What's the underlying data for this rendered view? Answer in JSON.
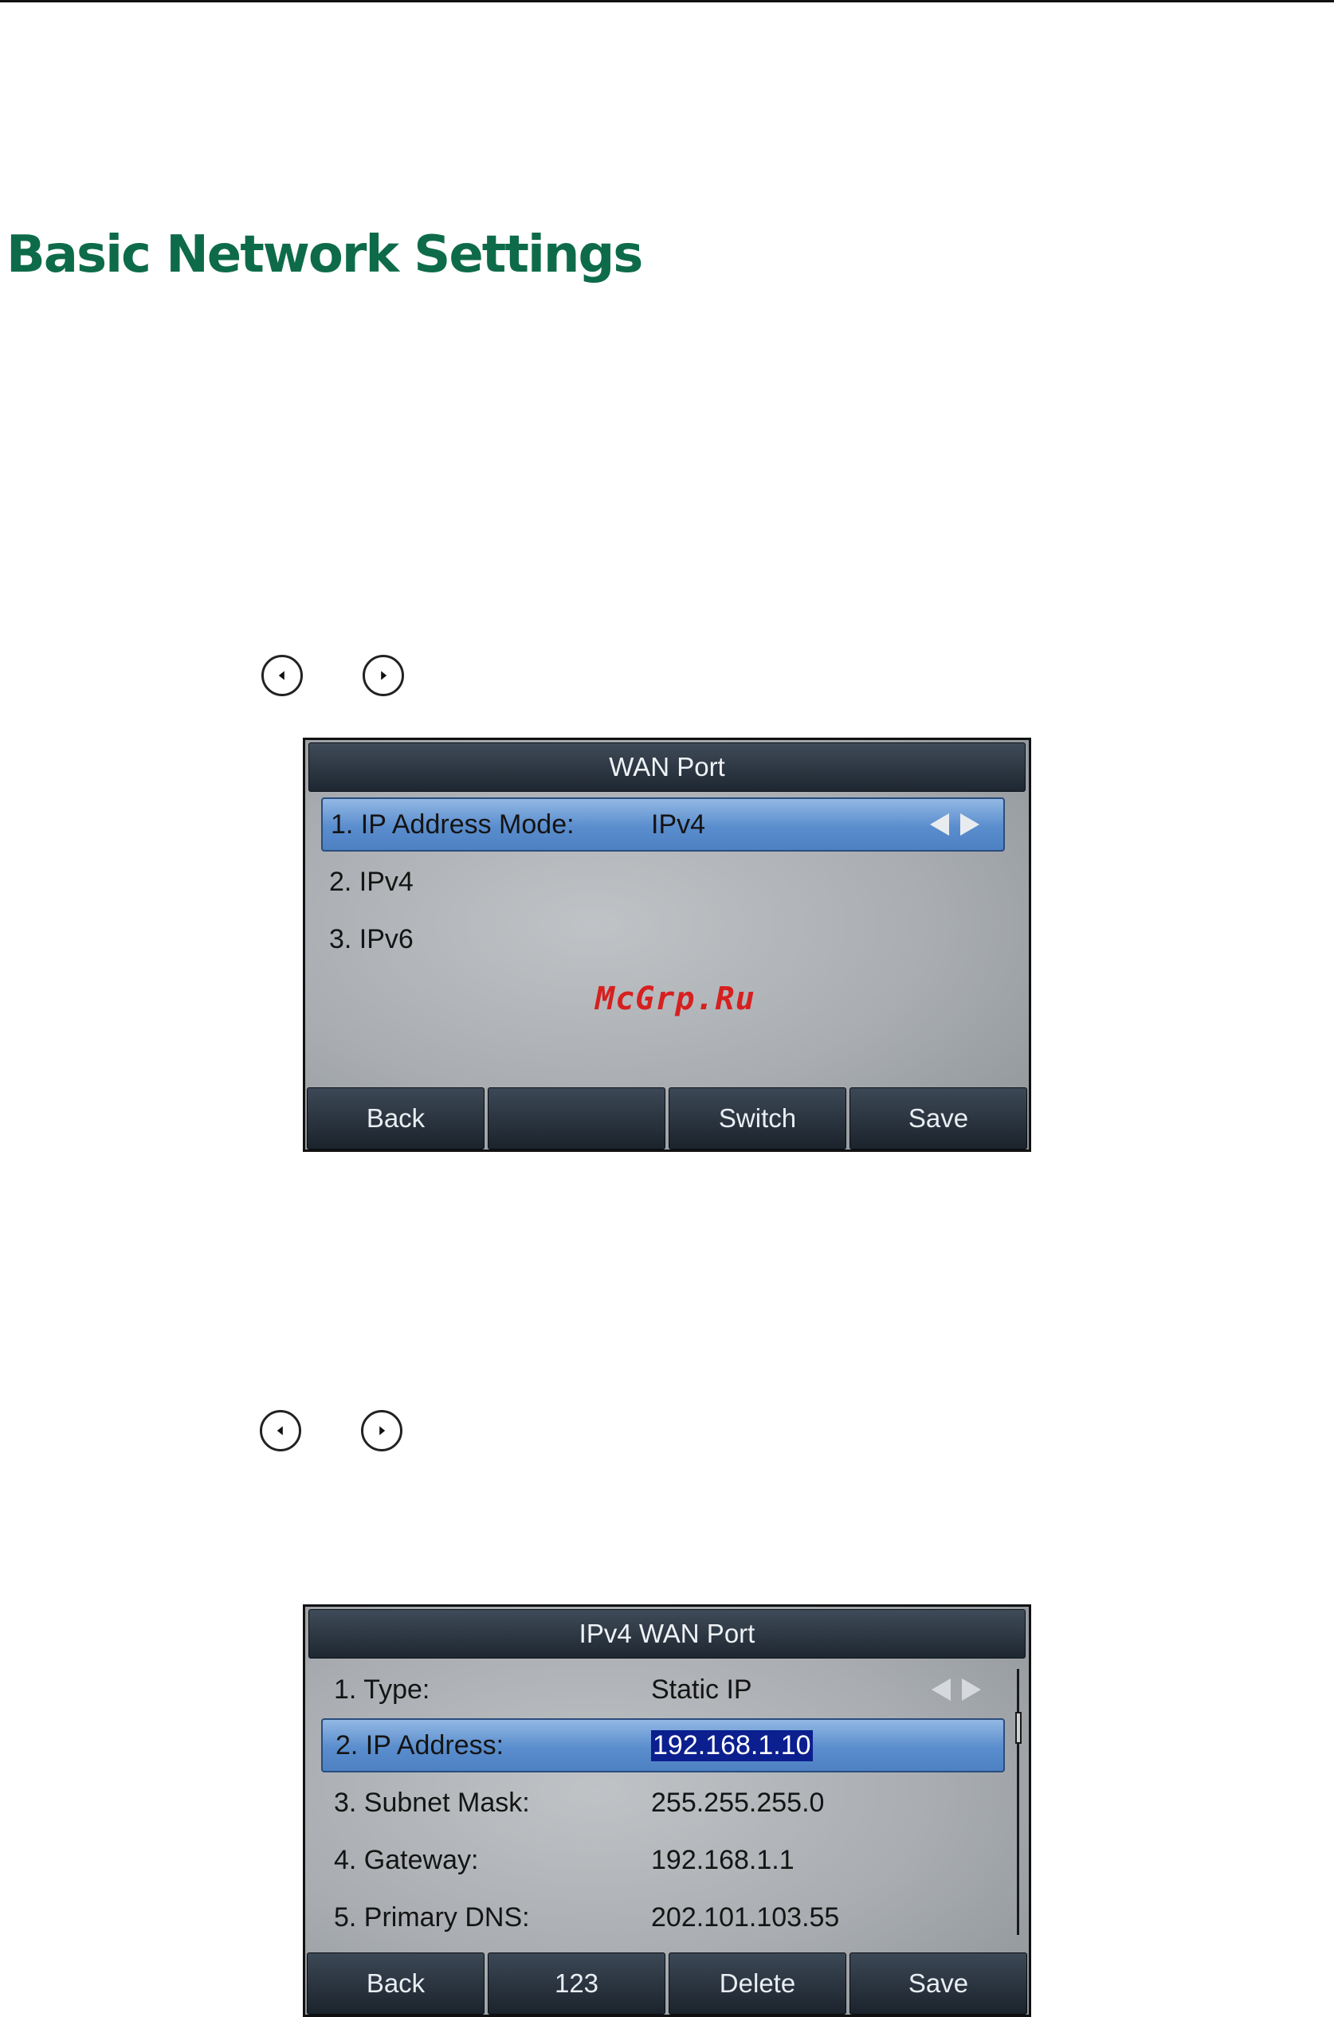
{
  "page": {
    "title": "Basic Network Settings"
  },
  "screen1": {
    "title": "WAN Port",
    "rows": [
      {
        "label": "1. IP Address Mode:",
        "value": "IPv4"
      },
      {
        "label": "2. IPv4",
        "value": ""
      },
      {
        "label": "3. IPv6",
        "value": ""
      }
    ],
    "softkeys": [
      "Back",
      "",
      "Switch",
      "Save"
    ],
    "watermark": "McGrp.Ru"
  },
  "screen2": {
    "title": "IPv4 WAN Port",
    "rows": [
      {
        "label": "1. Type:",
        "value": "Static IP"
      },
      {
        "label": "2. IP Address:",
        "value": "192.168.1.10"
      },
      {
        "label": "3. Subnet Mask:",
        "value": "255.255.255.0"
      },
      {
        "label": "4. Gateway:",
        "value": "192.168.1.1"
      },
      {
        "label": "5. Primary DNS:",
        "value": "202.101.103.55"
      }
    ],
    "softkeys": [
      "Back",
      "123",
      "Delete",
      "Save"
    ]
  },
  "icons": [
    "nav-left-key-icon",
    "nav-right-key-icon",
    "arrow-left-icon",
    "arrow-right-icon"
  ],
  "colors": {
    "heading": "#0e6b4a",
    "selection": "#5a8dcd",
    "watermark": "#d62020"
  }
}
